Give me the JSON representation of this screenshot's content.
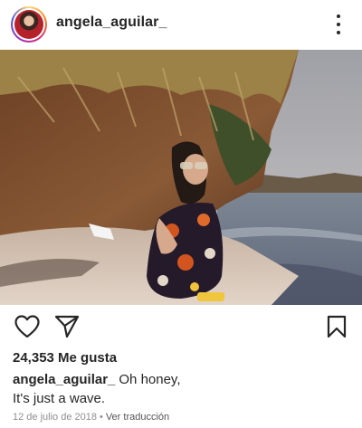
{
  "post": {
    "username": "angela_aguilar_",
    "avatar_icon": "profile-avatar",
    "menu_icon": "more-vertical-icon",
    "photo_alt": "",
    "likes_text": "24,353 Me gusta",
    "caption_user": "angela_aguilar_",
    "caption_line1": "Oh honey,",
    "caption_line2": "It's just a wave.",
    "date": "12 de julio de 2018",
    "separator": "•",
    "translate_label": "Ver traducción"
  },
  "actions": {
    "like_icon": "heart-icon",
    "share_icon": "send-icon",
    "save_icon": "bookmark-icon"
  },
  "colors": {
    "text": "#262626",
    "muted": "#8e8e8e",
    "background": "#ffffff"
  }
}
